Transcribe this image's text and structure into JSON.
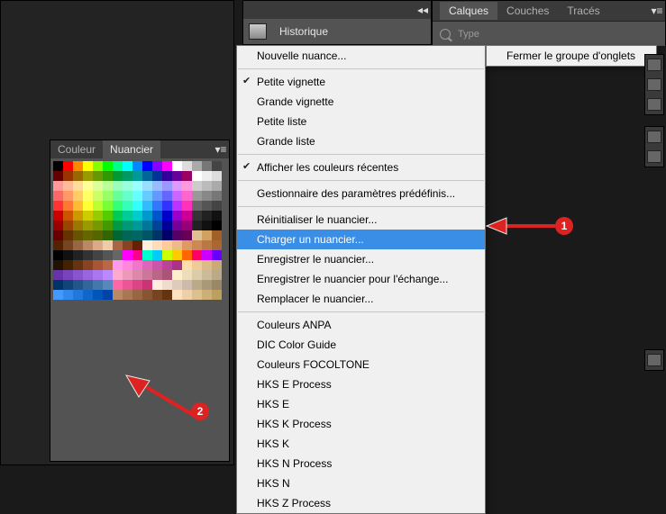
{
  "swatches_panel": {
    "tabs": {
      "couleur": "Couleur",
      "nuancier": "Nuancier"
    },
    "active_tab": "nuancier"
  },
  "history_panel": {
    "tab_label": "Historique"
  },
  "layers_strip": {
    "tabs": {
      "calques": "Calques",
      "couches": "Couches",
      "traces": "Tracés"
    },
    "active_tab": "calques",
    "search_kind": "Type"
  },
  "context_menu": {
    "new_swatch": "Nouvelle nuance...",
    "thumb_small": "Petite vignette",
    "thumb_large": "Grande vignette",
    "list_small": "Petite liste",
    "list_large": "Grande liste",
    "show_recent": "Afficher les couleurs récentes",
    "preset_mgr": "Gestionnaire des paramètres prédéfinis...",
    "reset": "Réinitialiser le nuancier...",
    "load": "Charger un nuancier...",
    "save": "Enregistrer le nuancier...",
    "save_exchange": "Enregistrer le nuancier pour l'échange...",
    "replace": "Remplacer le nuancier...",
    "presets": [
      "Couleurs ANPA",
      "DIC Color Guide",
      "Couleurs FOCOLTONE",
      "HKS E Process",
      "HKS E",
      "HKS K Process",
      "HKS K",
      "HKS N Process",
      "HKS N",
      "HKS Z Process"
    ],
    "highlighted": "load",
    "checked_items": [
      "thumb_small",
      "show_recent"
    ]
  },
  "side_menu": {
    "close_group": "Fermer le groupe d'onglets"
  },
  "annotations": {
    "badge1": "1",
    "badge2": "2"
  },
  "swatch_rows": [
    [
      "#000000",
      "#ff0000",
      "#ff8800",
      "#ffff00",
      "#88ff00",
      "#00ff00",
      "#00ff88",
      "#00ffff",
      "#0088ff",
      "#0000ff",
      "#8800ff",
      "#ff00ff",
      "#ffffff",
      "#dddddd",
      "#aaaaaa",
      "#777777",
      "#444444"
    ],
    [
      "#660000",
      "#993300",
      "#996600",
      "#999900",
      "#669900",
      "#339900",
      "#009933",
      "#009966",
      "#009999",
      "#006699",
      "#003399",
      "#330099",
      "#660099",
      "#990066",
      "#ffffff",
      "#eeeeee",
      "#dddddd"
    ],
    [
      "#ff9999",
      "#ffbb99",
      "#ffdd99",
      "#ffff99",
      "#ddff99",
      "#bbff99",
      "#99ffbb",
      "#99ffdd",
      "#99ffff",
      "#99ddff",
      "#99bbff",
      "#9999ff",
      "#dd99ff",
      "#ff99dd",
      "#cccccc",
      "#bbbbbb",
      "#aaaaaa"
    ],
    [
      "#ff6666",
      "#ff9966",
      "#ffcc66",
      "#ffff66",
      "#ccff66",
      "#99ff66",
      "#66ff99",
      "#66ffcc",
      "#66ffff",
      "#66ccff",
      "#6699ff",
      "#6666ff",
      "#cc66ff",
      "#ff66cc",
      "#999999",
      "#888888",
      "#777777"
    ],
    [
      "#ff3333",
      "#ff7733",
      "#ffbb33",
      "#ffff33",
      "#bbff33",
      "#77ff33",
      "#33ff77",
      "#33ffbb",
      "#33ffff",
      "#33bbff",
      "#3377ff",
      "#3333ff",
      "#bb33ff",
      "#ff33bb",
      "#666666",
      "#555555",
      "#444444"
    ],
    [
      "#cc0000",
      "#cc5500",
      "#cc9900",
      "#cccc00",
      "#99cc00",
      "#55cc00",
      "#00cc55",
      "#00cc99",
      "#00cccc",
      "#0099cc",
      "#0055cc",
      "#0000cc",
      "#9900cc",
      "#cc0099",
      "#333333",
      "#222222",
      "#111111"
    ],
    [
      "#990000",
      "#994400",
      "#997700",
      "#999900",
      "#779900",
      "#449900",
      "#009944",
      "#009977",
      "#009999",
      "#007799",
      "#004499",
      "#000099",
      "#770099",
      "#990077",
      "#222222",
      "#111111",
      "#000000"
    ],
    [
      "#660000",
      "#663300",
      "#665500",
      "#666600",
      "#556600",
      "#336600",
      "#006633",
      "#006655",
      "#006666",
      "#005566",
      "#003366",
      "#000066",
      "#550066",
      "#660055",
      "#e0c090",
      "#d2a060",
      "#a06028"
    ],
    [
      "#552200",
      "#774422",
      "#996644",
      "#bb8866",
      "#ddaa88",
      "#eeccaa",
      "#aa6644",
      "#884422",
      "#662200",
      "#ffeedd",
      "#ffddbb",
      "#ffcc99",
      "#eebb88",
      "#dd9966",
      "#cc8855",
      "#bb7744",
      "#aa6633"
    ],
    [
      "#000000",
      "#111111",
      "#222222",
      "#333333",
      "#444444",
      "#555555",
      "#666666",
      "#ff00ff",
      "#ff0088",
      "#00ffcc",
      "#00ccff",
      "#ccff00",
      "#ffcc00",
      "#ff6600",
      "#ff0066",
      "#cc00ff",
      "#6600ff"
    ],
    [
      "#221100",
      "#442200",
      "#663311",
      "#884422",
      "#aa5533",
      "#bb6644",
      "#ff99ee",
      "#ff88dd",
      "#ee77cc",
      "#dd66bb",
      "#cc55aa",
      "#bb4499",
      "#aa3388",
      "#ffddaa",
      "#eecc99",
      "#ddbb88",
      "#ccaa77"
    ],
    [
      "#6633aa",
      "#7744bb",
      "#8855cc",
      "#9966dd",
      "#aa77ee",
      "#bb88ff",
      "#ffaacc",
      "#ee99bb",
      "#dd88aa",
      "#cc7799",
      "#bb6688",
      "#aa5577",
      "#ffeecc",
      "#eeddbb",
      "#ddccaa",
      "#ccbb99",
      "#bbaa88"
    ],
    [
      "#003366",
      "#114477",
      "#225588",
      "#336699",
      "#4477aa",
      "#5588bb",
      "#ff66aa",
      "#ee5599",
      "#dd4488",
      "#cc3377",
      "#ffeedd",
      "#eeddcc",
      "#ddccbb",
      "#ccbbaa",
      "#bba988",
      "#aa9877",
      "#998866"
    ],
    [
      "#4499ff",
      "#3388ee",
      "#2277dd",
      "#1166cc",
      "#0055bb",
      "#0044aa",
      "#bb8866",
      "#aa7755",
      "#996644",
      "#885533",
      "#774422",
      "#663311",
      "#ffe0c0",
      "#eed0a8",
      "#ddc090",
      "#ccb078",
      "#bba060"
    ]
  ]
}
